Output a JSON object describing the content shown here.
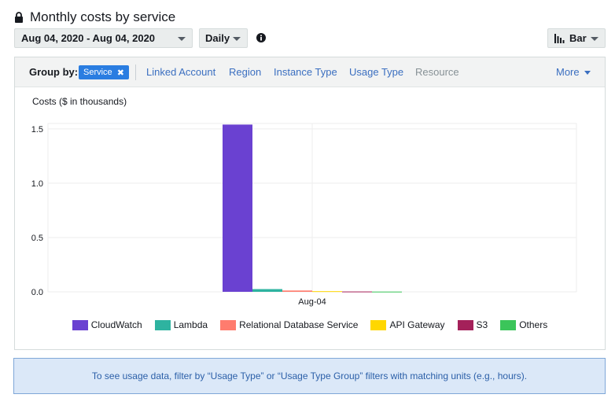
{
  "header": {
    "title": "Monthly costs by service",
    "lock_icon": "lock-icon"
  },
  "toolbar": {
    "date_range": "Aug 04, 2020 - Aug 04, 2020",
    "granularity": "Daily",
    "info_icon": "info-icon",
    "chart_type": "Bar",
    "chart_type_icon": "bar-chart-icon"
  },
  "group_by": {
    "label": "Group by:",
    "selected": "Service",
    "options": [
      "Linked Account",
      "Region",
      "Instance Type",
      "Usage Type",
      "Resource"
    ],
    "more": "More"
  },
  "colors": {
    "CloudWatch": "#6a41d1",
    "Lambda": "#2eb3a0",
    "Relational Database Service": "#ff7c6e",
    "API Gateway": "#ffd700",
    "S3": "#a4215a",
    "Others": "#3bc55a"
  },
  "chart_data": {
    "type": "bar",
    "ylabel": "Costs ($ in thousands)",
    "xlabel": "",
    "categories": [
      "Aug-04"
    ],
    "ylim": [
      0,
      1.55
    ],
    "yticks": [
      "0.0",
      "0.5",
      "1.0",
      "1.5"
    ],
    "ytick_values": [
      0,
      0.5,
      1.0,
      1.5
    ],
    "grid": true,
    "legend_position": "bottom",
    "series": [
      {
        "name": "CloudWatch",
        "values": [
          1.54
        ]
      },
      {
        "name": "Lambda",
        "values": [
          0.025
        ]
      },
      {
        "name": "Relational Database Service",
        "values": [
          0.012
        ]
      },
      {
        "name": "API Gateway",
        "values": [
          0.006
        ]
      },
      {
        "name": "S3",
        "values": [
          0.003
        ]
      },
      {
        "name": "Others",
        "values": [
          0.002
        ]
      }
    ]
  },
  "info_banner": "To see usage data, filter by “Usage Type” or “Usage Type Group” filters with matching units (e.g., hours)."
}
